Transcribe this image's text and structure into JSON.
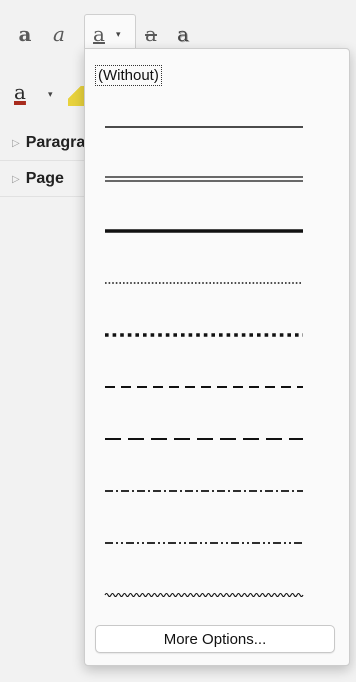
{
  "toolbar": {
    "bold_icon": "bold-icon",
    "italic_icon": "italic-icon",
    "underline_icon": "underline-icon",
    "strikethrough_icon": "strikethrough-icon",
    "shadow_icon": "shadow-icon",
    "glyph": "a",
    "dropdown_glyph": "▾",
    "font_color_icon": "font-color-icon",
    "highlight_icon": "highlight-icon",
    "font_color_accent": "#a82b1d",
    "highlight_accent": "#e8d23c"
  },
  "sections": [
    {
      "label": "Paragraph",
      "arrow": "▷"
    },
    {
      "label": "Page",
      "arrow": "▷"
    }
  ],
  "underline_menu": {
    "without_label": "(Without)",
    "options": [
      {
        "name": "single"
      },
      {
        "name": "double"
      },
      {
        "name": "bold"
      },
      {
        "name": "dotted"
      },
      {
        "name": "bold-dotted"
      },
      {
        "name": "dash"
      },
      {
        "name": "long-dash"
      },
      {
        "name": "dash-dot"
      },
      {
        "name": "dash-dot-dot"
      },
      {
        "name": "wave"
      }
    ],
    "more_options_label": "More Options..."
  }
}
